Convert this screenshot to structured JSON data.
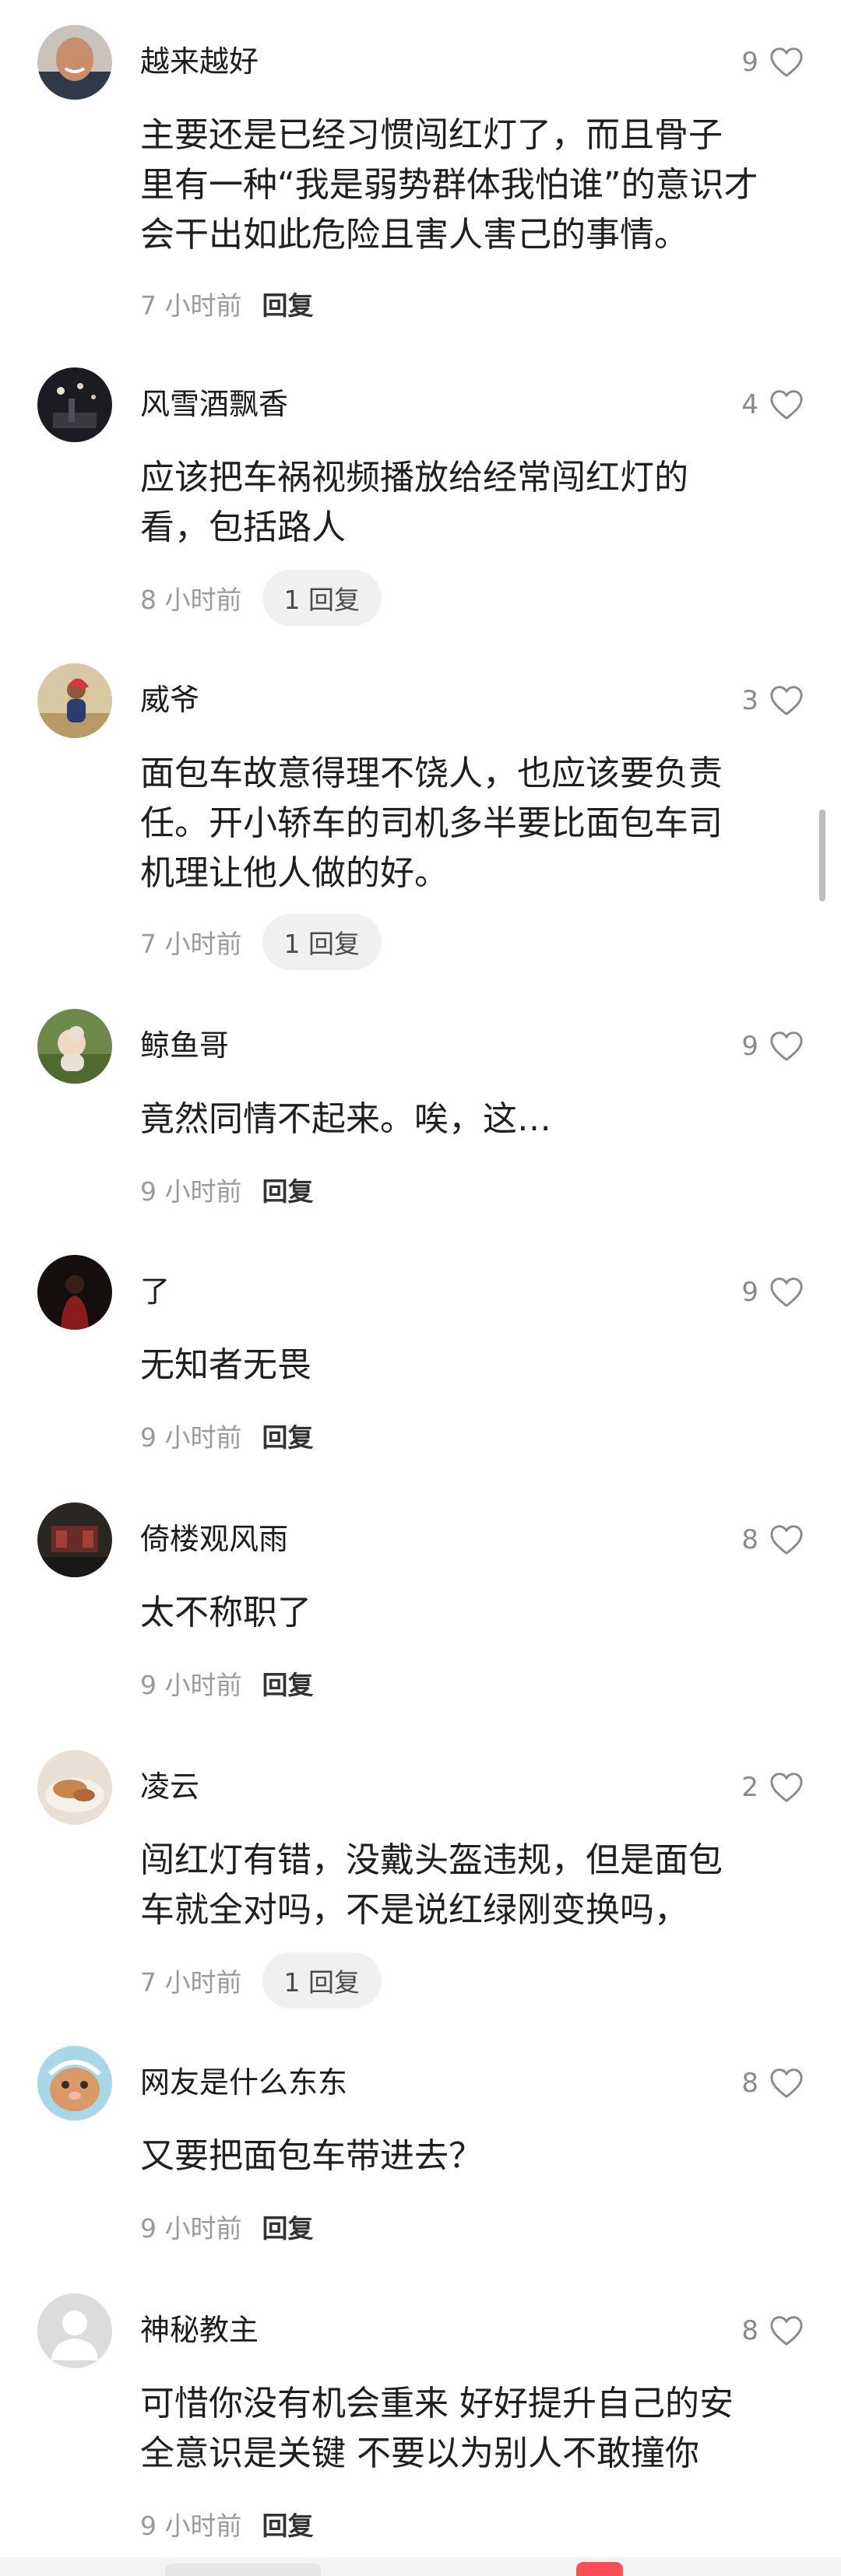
{
  "comments": [
    {
      "user": "越来越好",
      "likes": "9",
      "lines": [
        "主要还是已经习惯闯红灯了，而且骨子",
        "里有一种“我是弱势群体我怕谁”的意识才",
        "会干出如此危险且害人害己的事情。"
      ],
      "time": "7 小时前",
      "reply": "回复",
      "reply_style": "link",
      "avatar": "avatar-man-smiling"
    },
    {
      "user": "风雪酒飘香",
      "likes": "4",
      "lines": [
        "应该把车祸视频播放给经常闯红灯的",
        "看，包括路人"
      ],
      "time": "8 小时前",
      "reply": "1 回复",
      "reply_style": "pill",
      "avatar": "avatar-night-lights"
    },
    {
      "user": "威爷",
      "likes": "3",
      "lines": [
        "面包车故意得理不饶人，也应该要负责",
        "任。开小轿车的司机多半要比面包车司",
        "机理让他人做的好。"
      ],
      "time": "7 小时前",
      "reply": "1 回复",
      "reply_style": "pill",
      "avatar": "avatar-person-red-scarf"
    },
    {
      "user": "鲸鱼哥",
      "likes": "9",
      "lines": [
        "竟然同情不起来。唉，这…"
      ],
      "time": "9 小时前",
      "reply": "回复",
      "reply_style": "link",
      "avatar": "avatar-baby-grass"
    },
    {
      "user": "了",
      "likes": "9",
      "lines": [
        "无知者无畏"
      ],
      "time": "9 小时前",
      "reply": "回复",
      "reply_style": "link",
      "avatar": "avatar-dark-figure"
    },
    {
      "user": "倚楼观风雨",
      "likes": "8",
      "lines": [
        "太不称职了"
      ],
      "time": "9 小时前",
      "reply": "回复",
      "reply_style": "link",
      "avatar": "avatar-dark-room"
    },
    {
      "user": "凌云",
      "likes": "2",
      "lines": [
        "闯红灯有错，没戴头盔违规，但是面包",
        "车就全对吗，不是说红绿刚变换吗，"
      ],
      "time": "7 小时前",
      "reply": "1 回复",
      "reply_style": "pill",
      "avatar": "avatar-food-plate"
    },
    {
      "user": "网友是什么东东",
      "likes": "8",
      "lines": [
        "又要把面包车带进去？"
      ],
      "time": "9 小时前",
      "reply": "回复",
      "reply_style": "link",
      "avatar": "avatar-cartoon-creature"
    },
    {
      "user": "神秘教主",
      "likes": "8",
      "lines": [
        "可惜你没有机会重来 好好提升自己的安",
        "全意识是关键 不要以为别人不敢撞你"
      ],
      "time": "9 小时前",
      "reply": "回复",
      "reply_style": "link",
      "avatar": "avatar-default-gray"
    }
  ],
  "colors": {
    "text": "#1f1f1f",
    "meta": "#9a9a9a",
    "pill_bg": "#f0f0f0",
    "heart": "#8a8a8a"
  }
}
